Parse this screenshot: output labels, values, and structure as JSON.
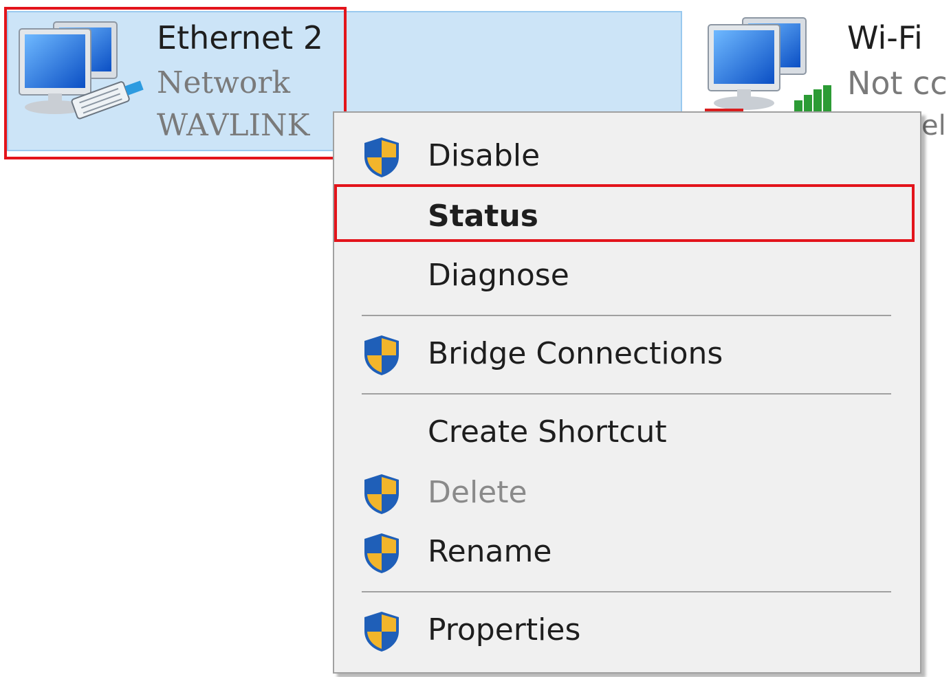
{
  "ethernet": {
    "name": "Ethernet 2",
    "network": "Network",
    "adapter": "WAVLINK",
    "icon": "network-adapter-icon"
  },
  "wifi": {
    "name": "Wi-Fi",
    "status": "Not cc",
    "extra": "el",
    "icon": "wifi-adapter-icon"
  },
  "context_menu": {
    "items": [
      {
        "label": "Disable",
        "shield": true
      },
      {
        "label": "Status",
        "bold": true,
        "highlighted": true
      },
      {
        "label": "Diagnose"
      },
      {
        "label": "Bridge Connections",
        "shield": true
      },
      {
        "label": "Create Shortcut"
      },
      {
        "label": "Delete",
        "shield": true,
        "disabled": true
      },
      {
        "label": "Rename",
        "shield": true
      },
      {
        "label": "Properties",
        "shield": true
      }
    ]
  },
  "colors": {
    "selection": "#cce4f7",
    "highlight_border": "#e3141b",
    "menu_bg": "#f0f0f0",
    "shield_blue": "#1f5fb8",
    "shield_gold": "#f2b52b"
  }
}
